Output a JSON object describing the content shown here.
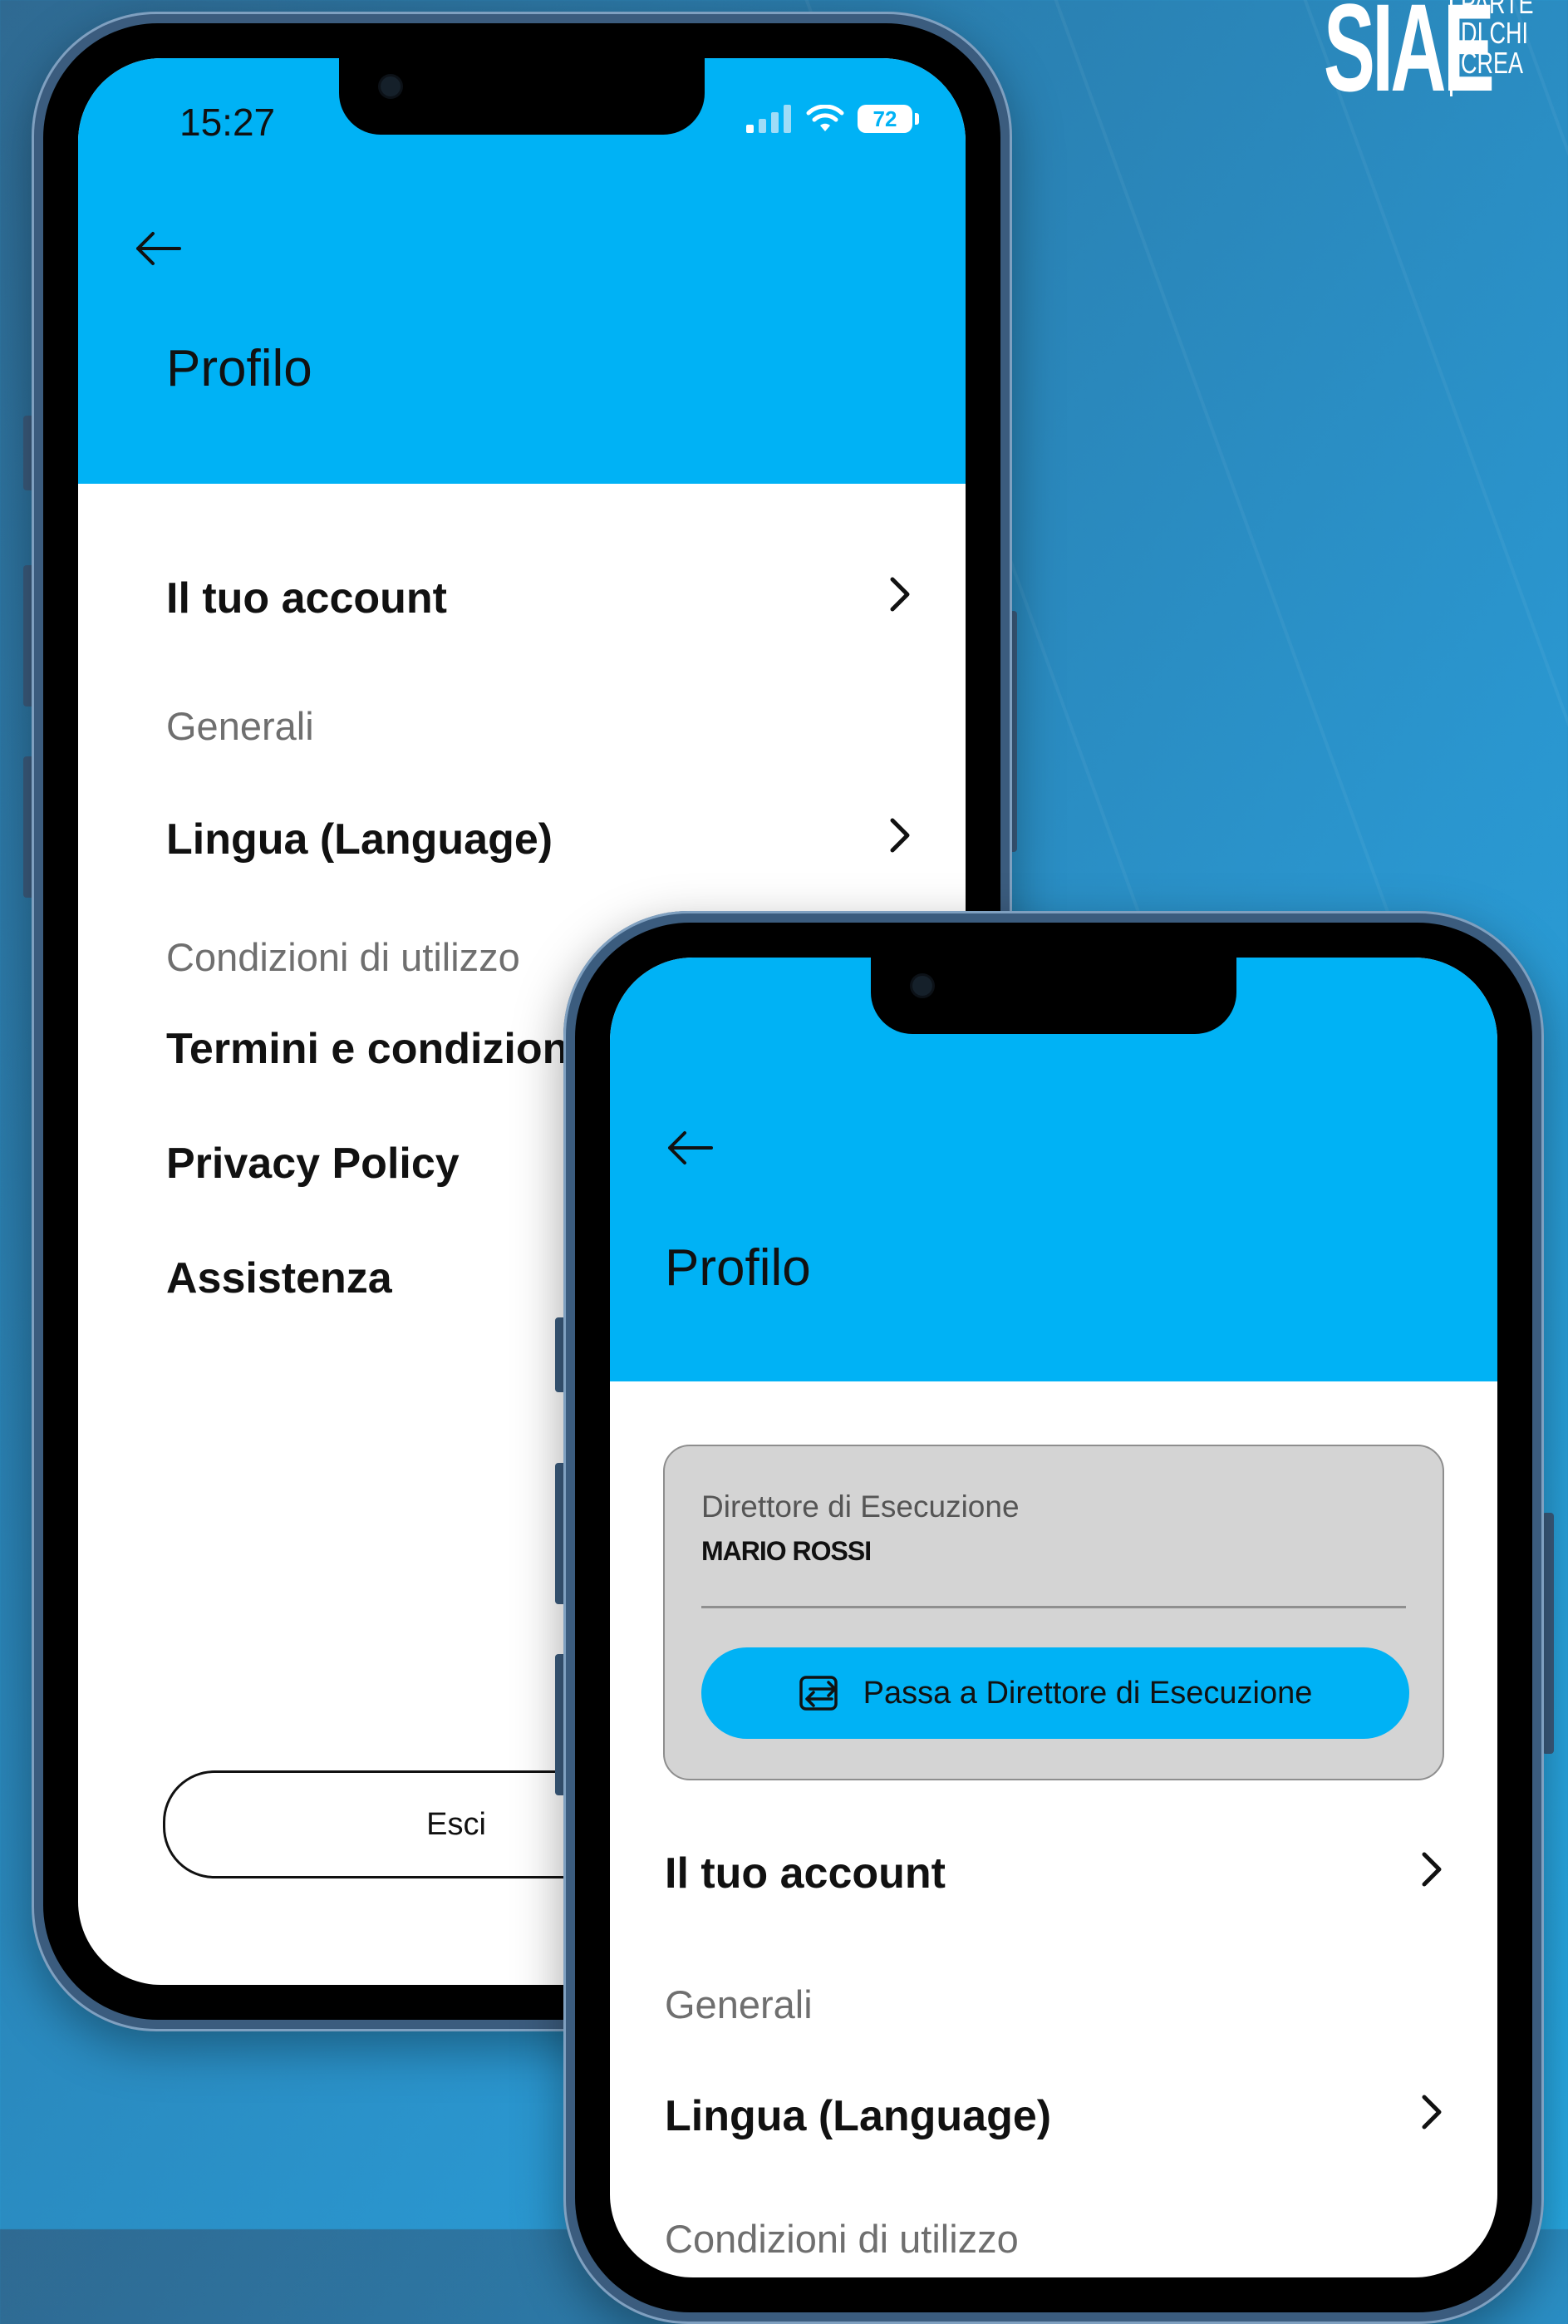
{
  "brand": {
    "logo_text": "SIAE",
    "tagline": [
      "PARTE",
      "DI CHI",
      "CREA"
    ]
  },
  "colors": {
    "header": "#00b2f5",
    "accent_button": "#00b2f5",
    "card_bg": "#d4d4d4"
  },
  "back_phone": {
    "status_bar": {
      "time": "15:27",
      "battery_percent": "72",
      "icons": [
        "signal-icon",
        "wifi-icon",
        "battery-icon"
      ]
    },
    "header": {
      "back_icon": "arrow-left-icon",
      "title": "Profilo"
    },
    "menu": {
      "account": "Il tuo account",
      "section_general": "Generali",
      "language": "Lingua (Language)",
      "section_terms": "Condizioni di utilizzo",
      "terms": "Termini e condizioni",
      "privacy": "Privacy Policy",
      "support": "Assistenza"
    },
    "logout_label": "Esci"
  },
  "front_phone": {
    "header": {
      "back_icon": "arrow-left-icon",
      "title": "Profilo"
    },
    "role_card": {
      "role": "Direttore di Esecuzione",
      "name": "MARIO ROSSI",
      "switch_button": "Passa a Direttore di Esecuzione",
      "switch_icon": "swap-icon"
    },
    "menu": {
      "account": "Il tuo account",
      "section_general": "Generali",
      "language": "Lingua (Language)",
      "section_terms": "Condizioni di utilizzo"
    }
  }
}
